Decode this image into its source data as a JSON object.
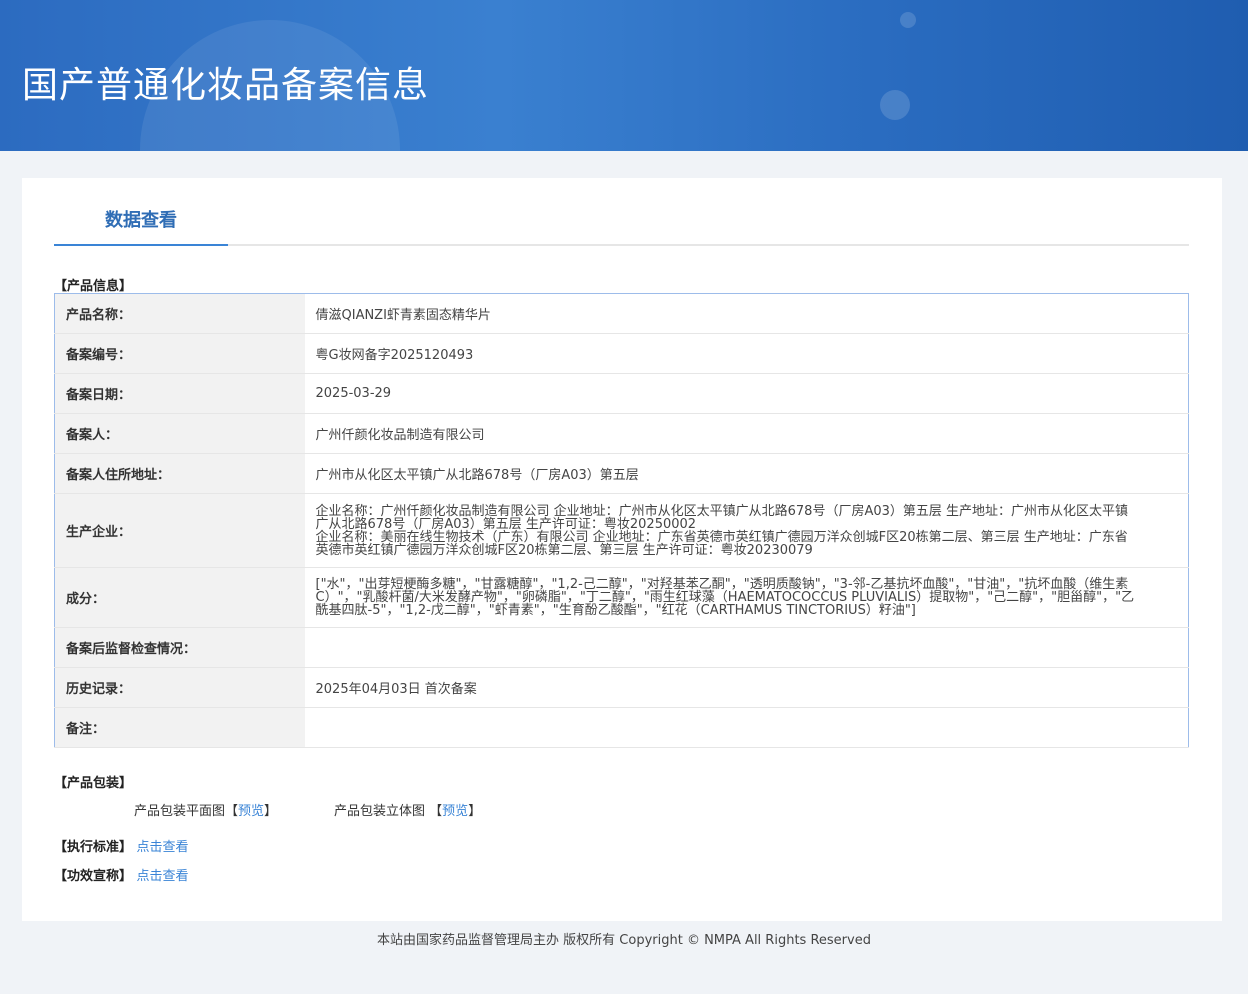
{
  "header": {
    "title": "国产普通化妆品备案信息"
  },
  "tab": "数据查看",
  "product_section": "【产品信息】",
  "rows": [
    {
      "label": "产品名称：",
      "value": "倩滋QIANZI虾青素固态精华片"
    },
    {
      "label": "备案编号：",
      "value": "粤G妆网备字2025120493"
    },
    {
      "label": "备案日期：",
      "value": "2025-03-29"
    },
    {
      "label": "备案人：",
      "value": "广州仟颜化妆品制造有限公司"
    },
    {
      "label": "备案人住所地址：",
      "value": "广州市从化区太平镇广从北路678号（厂房A03）第五层"
    },
    {
      "label": "生产企业：",
      "lines": [
        "企业名称：广州仟颜化妆品制造有限公司 企业地址：广州市从化区太平镇广从北路678号（厂房A03）第五层 生产地址：广州市从化区太平镇广从北路678号（厂房A03）第五层 生产许可证：粤妆20250002",
        "企业名称：美丽在线生物技术（广东）有限公司 企业地址：广东省英德市英红镇广德园万洋众创城F区20栋第二层、第三层 生产地址：广东省英德市英红镇广德园万洋众创城F区20栋第二层、第三层 生产许可证：粤妆20230079"
      ]
    },
    {
      "label": "成分：",
      "value": "[\"水\"，\"出芽短梗酶多糖\"，\"甘露糖醇\"，\"1,2-己二醇\"，\"对羟基苯乙酮\"，\"透明质酸钠\"，\"3-邻-乙基抗坏血酸\"，\"甘油\"，\"抗坏血酸（维生素C）\"，\"乳酸杆菌/大米发酵产物\"，\"卵磷脂\"，\"丁二醇\"，\"雨生红球藻（HAEMATOCOCCUS PLUVIALIS）提取物\"，\"己二醇\"，\"胆甾醇\"，\"乙酰基四肽-5\"，\"1,2-戊二醇\"，\"虾青素\"，\"生育酚乙酸酯\"，\"红花（CARTHAMUS TINCTORIUS）籽油\"]"
    },
    {
      "label": "备案后监督检查情况：",
      "value": ""
    },
    {
      "label": "历史记录：",
      "value": "2025年04月03日 首次备案"
    },
    {
      "label": "备注：",
      "value": ""
    }
  ],
  "packaging": {
    "section": "【产品包装】",
    "flat_label": "产品包装平面图",
    "solid_label": "产品包装立体图",
    "lb": "【",
    "rb": "】",
    "preview": "预览"
  },
  "standard": {
    "label": "【执行标准】",
    "link": "点击查看"
  },
  "efficacy": {
    "label": "【功效宣称】",
    "link": "点击查看"
  },
  "footer": "本站由国家药品监督管理局主办 版权所有 Copyright © NMPA All Rights Reserved"
}
